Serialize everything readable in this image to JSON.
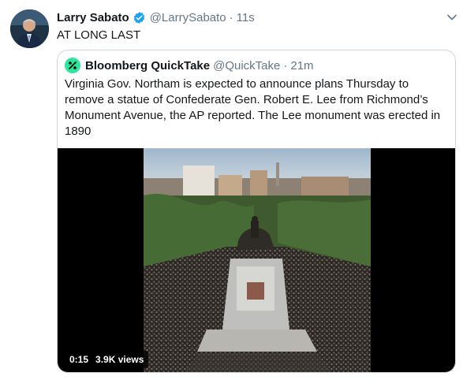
{
  "tweet": {
    "author_name": "Larry Sabato",
    "author_handle": "@LarrySabato",
    "separator": "·",
    "time": "11s",
    "text": "AT LONG LAST",
    "verified_icon": "verified-badge-icon",
    "menu_icon": "chevron-down-icon"
  },
  "quoted": {
    "author_name": "Bloomberg QuickTake",
    "author_handle": "@QuickTake",
    "separator": "·",
    "time": "21m",
    "text": "Virginia Gov. Northam is expected to announce plans Thursday to remove a statue of Confederate Gen. Robert E. Lee from Richmond’s Monument Avenue, the AP reported. The Lee monument was erected in 1890",
    "media": {
      "duration": "0:15",
      "views": "3.9K views"
    }
  },
  "colors": {
    "verified_blue": "#1da1f2",
    "quicktake_green": "#2ee59d",
    "muted_text": "#657786",
    "border": "#ccd6dd"
  }
}
